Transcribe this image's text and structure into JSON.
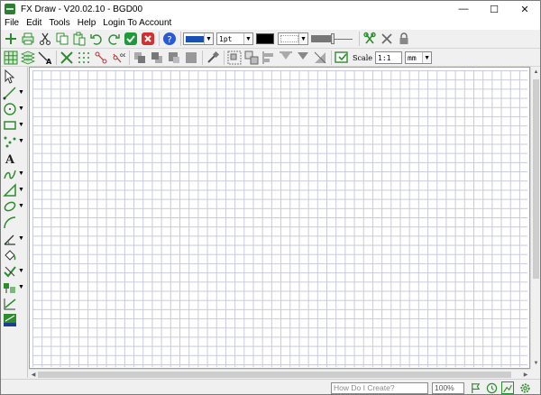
{
  "window": {
    "title": "FX Draw - V20.02.10 - BGD00",
    "controls": {
      "minimize": "—",
      "maximize": "☐",
      "close": "✕"
    }
  },
  "menu": {
    "items": [
      {
        "label": "File"
      },
      {
        "label": "Edit"
      },
      {
        "label": "Tools"
      },
      {
        "label": "Help"
      },
      {
        "label": "Login To Account"
      }
    ]
  },
  "toolbar1": {
    "line_width": "1pt",
    "icons": [
      "new-icon",
      "print-icon",
      "cut-icon",
      "copy-icon",
      "paste-icon",
      "undo-icon",
      "redo-icon",
      "ok-icon",
      "cancel-icon",
      "help-icon"
    ]
  },
  "toolbar2": {
    "scale_label": "Scale",
    "scale_value": "1:1",
    "scale_unit": "mm"
  },
  "status": {
    "help_placeholder": "How Do I Create?",
    "zoom": "100%"
  },
  "colors": {
    "accent_green": "#2e8b2e",
    "cancel_red": "#d32f2f",
    "help_blue": "#2a5bd7",
    "grid_line": "#c9c9dd"
  }
}
